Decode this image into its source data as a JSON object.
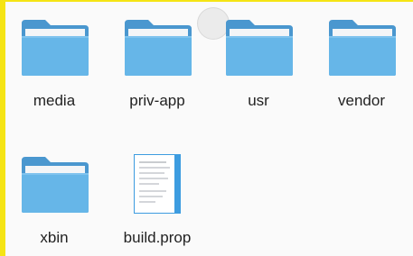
{
  "items": [
    {
      "label": "media",
      "type": "folder",
      "icon": "folder-icon"
    },
    {
      "label": "priv-app",
      "type": "folder",
      "icon": "folder-icon"
    },
    {
      "label": "usr",
      "type": "folder",
      "icon": "folder-icon"
    },
    {
      "label": "vendor",
      "type": "folder",
      "icon": "folder-icon"
    },
    {
      "label": "xbin",
      "type": "folder",
      "icon": "folder-icon"
    },
    {
      "label": "build.prop",
      "type": "file",
      "icon": "document-icon"
    }
  ],
  "colors": {
    "highlight_border": "#f5e414",
    "folder_back": "#66b6e8",
    "folder_front": "#5aaee5",
    "folder_tab": "#4a97cf",
    "folder_paper": "#f3f5f7",
    "doc_corner": "#3d9ce0",
    "background": "#fafafa"
  }
}
